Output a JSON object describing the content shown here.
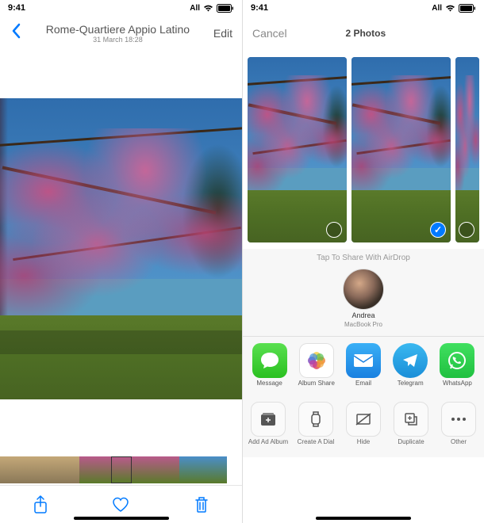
{
  "left": {
    "status": {
      "time": "9:41",
      "carrier": "All"
    },
    "nav": {
      "title": "Rome-Quartiere Appio Latino",
      "subtitle": "31 March 18:28",
      "edit": "Edit"
    },
    "toolbar": {
      "share": "share",
      "like": "like",
      "trash": "trash"
    }
  },
  "right": {
    "status": {
      "time": "9:41",
      "carrier": "All"
    },
    "nav": {
      "cancel": "Cancel",
      "count": "2 Photos"
    },
    "airdrop_hint": "Tap To Share With AirDrop",
    "contact": {
      "name": "Andrea",
      "device": "MacBook Pro"
    },
    "apps": [
      {
        "label": "Message"
      },
      {
        "label": "Album Share"
      },
      {
        "label": "Email"
      },
      {
        "label": "Telegram"
      },
      {
        "label": "WhatsApp"
      }
    ],
    "actions": [
      {
        "label": "Add Ad Album"
      },
      {
        "label": "Create A Dial"
      },
      {
        "label": "Hide"
      },
      {
        "label": "Duplicate"
      },
      {
        "label": "Other"
      }
    ]
  }
}
